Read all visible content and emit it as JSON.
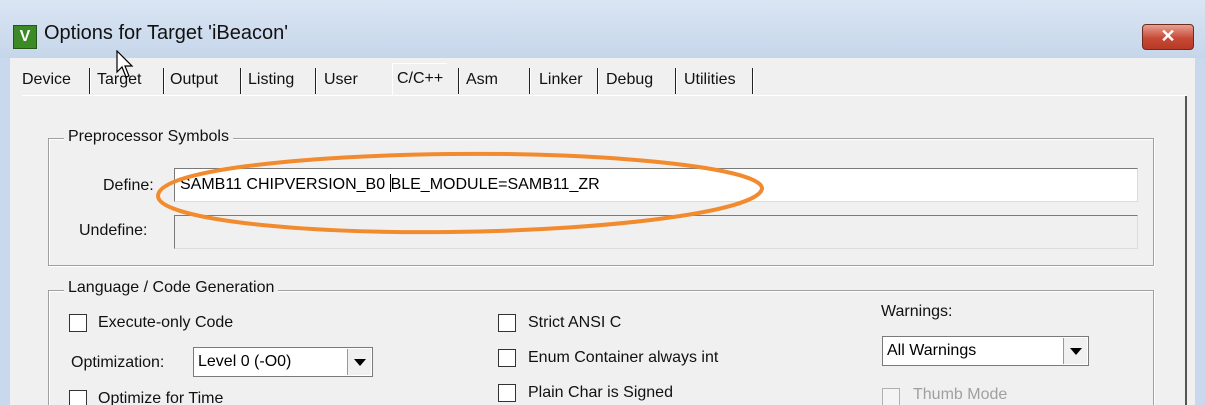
{
  "window": {
    "title": "Options for Target 'iBeacon'",
    "app_icon_glyph": "V",
    "close_glyph": "✕",
    "close_color": "#c64a35"
  },
  "tabs": [
    {
      "label": "Device"
    },
    {
      "label": "Target"
    },
    {
      "label": "Output"
    },
    {
      "label": "Listing"
    },
    {
      "label": "User"
    },
    {
      "label": "C/C++",
      "active": true
    },
    {
      "label": "Asm"
    },
    {
      "label": "Linker"
    },
    {
      "label": "Debug"
    },
    {
      "label": "Utilities"
    }
  ],
  "preprocessor": {
    "legend": "Preprocessor Symbols",
    "define_label": "Define:",
    "define_value_before_caret": "SAMB11 CHIPVERSION_B0 ",
    "define_value_after_caret": "BLE_MODULE=SAMB11_ZR",
    "undefine_label": "Undefine:",
    "undefine_value": ""
  },
  "codegen": {
    "legend": "Language / Code Generation",
    "execute_only": {
      "label": "Execute-only Code",
      "checked": false
    },
    "optimization_label": "Optimization:",
    "optimization_value": "Level 0 (-O0)",
    "optimize_for_time": {
      "label": "Optimize for Time",
      "checked": false
    },
    "strict_ansi": {
      "label": "Strict ANSI C",
      "checked": false
    },
    "enum_container": {
      "label": "Enum Container always int",
      "checked": false
    },
    "plain_char_signed": {
      "label": "Plain Char is Signed",
      "checked": false
    },
    "warnings_label": "Warnings:",
    "warnings_value": "All Warnings",
    "thumb_mode": {
      "label": "Thumb Mode",
      "checked": false,
      "disabled": true
    }
  },
  "annotation_color": "#f28a2e"
}
